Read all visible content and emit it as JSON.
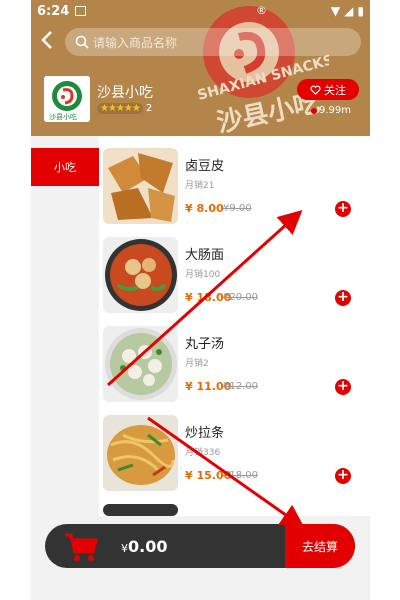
{
  "status_bar": {
    "time": "6:24",
    "center_symbol": "®"
  },
  "header": {
    "search_placeholder": "请输入商品名称",
    "store_name": "沙县小吃",
    "rating_count": "2",
    "follow_label": "关注",
    "distance": "9.99m",
    "background_color": "#b3854b",
    "logo_text": "沙县小吃",
    "logo_brand": "SHAXIAN SNACKS"
  },
  "categories": [
    {
      "label": "小吃",
      "active": true
    }
  ],
  "products": [
    {
      "name": "卤豆皮",
      "sales": "月销21",
      "price": "8.00",
      "original_price": "¥9.00",
      "currency": "¥"
    },
    {
      "name": "大肠面",
      "sales": "月销100",
      "price": "18.00",
      "original_price": "¥20.00",
      "currency": "¥"
    },
    {
      "name": "丸子汤",
      "sales": "月销2",
      "price": "11.00",
      "original_price": "¥12.00",
      "currency": "¥"
    },
    {
      "name": "炒拉条",
      "sales": "月销336",
      "price": "15.00",
      "original_price": "¥18.00",
      "currency": "¥"
    }
  ],
  "cart": {
    "currency": "¥",
    "total": "0.00",
    "checkout_label": "去结算"
  },
  "colors": {
    "accent": "#e30000",
    "price": "#e86a00",
    "cart_bar": "#333333"
  }
}
